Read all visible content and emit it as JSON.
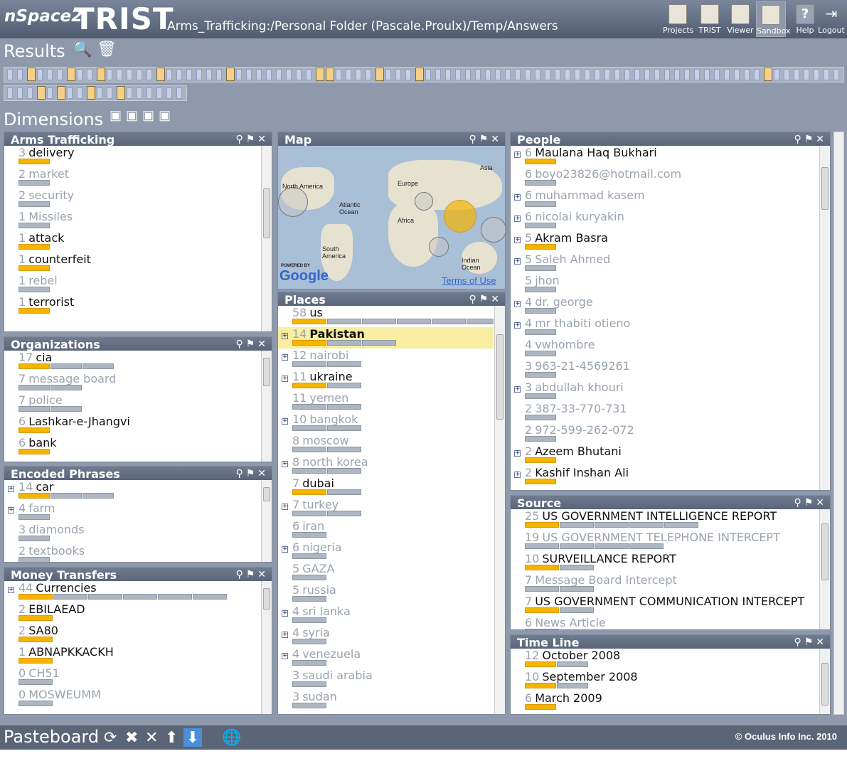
{
  "app": {
    "brand": "nSpace2",
    "product": "TRIST",
    "path": "Arms_Trafficking:/Personal Folder (Pascale.Proulx)/Temp/Answers"
  },
  "toolbar": [
    {
      "label": "Projects",
      "icon": "folders-icon"
    },
    {
      "label": "TRIST",
      "icon": "notebook-icon"
    },
    {
      "label": "Viewer",
      "icon": "document-viewer-icon"
    },
    {
      "label": "Sandbox",
      "icon": "sandbox-icon"
    },
    {
      "label": "Help",
      "icon": "help-icon"
    },
    {
      "label": "Logout",
      "icon": "logout-icon"
    }
  ],
  "results": {
    "title": "Results"
  },
  "dimensions": {
    "title": "Dimensions"
  },
  "pasteboard": {
    "title": "Pasteboard",
    "copyright": "© Oculus Info Inc. 2010"
  },
  "colors": {
    "accent": "#f5b400",
    "header": "#5a6579",
    "highlight": "#f8eda0"
  },
  "map": {
    "title": "Map",
    "labels": [
      "North America",
      "Europe",
      "Asia",
      "Atlantic Ocean",
      "Africa",
      "South America",
      "Indian Ocean"
    ],
    "terms": "Terms of Use",
    "powered": "POWERED BY",
    "google": "Google"
  },
  "panels": {
    "arms": {
      "title": "Arms Trafficking",
      "items": [
        {
          "c": "3",
          "l": "delivery",
          "d": false
        },
        {
          "c": "2",
          "l": "market",
          "d": true
        },
        {
          "c": "2",
          "l": "security",
          "d": true
        },
        {
          "c": "1",
          "l": "Missiles",
          "d": true
        },
        {
          "c": "1",
          "l": "attack",
          "d": false
        },
        {
          "c": "1",
          "l": "counterfeit",
          "d": false
        },
        {
          "c": "1",
          "l": "rebel",
          "d": true
        },
        {
          "c": "1",
          "l": "terrorist",
          "d": false
        }
      ]
    },
    "org": {
      "title": "Organizations",
      "items": [
        {
          "c": "17",
          "l": "cia",
          "d": false
        },
        {
          "c": "7",
          "l": "message board",
          "d": true
        },
        {
          "c": "7",
          "l": "police",
          "d": true
        },
        {
          "c": "6",
          "l": "Lashkar-e-Jhangvi",
          "d": false
        },
        {
          "c": "6",
          "l": "bank",
          "d": false
        }
      ]
    },
    "enc": {
      "title": "Encoded Phrases",
      "items": [
        {
          "c": "14",
          "l": "car",
          "d": false
        },
        {
          "c": "4",
          "l": "farm",
          "d": true
        },
        {
          "c": "3",
          "l": "diamonds",
          "d": true
        },
        {
          "c": "2",
          "l": "textbooks",
          "d": true
        }
      ]
    },
    "money": {
      "title": "Money Transfers",
      "items": [
        {
          "c": "44",
          "l": "Currencies",
          "d": false
        },
        {
          "c": "2",
          "l": "EBILAEAD",
          "d": false
        },
        {
          "c": "2",
          "l": "SA80",
          "d": false
        },
        {
          "c": "1",
          "l": "ABNAPKKACKH",
          "d": false
        },
        {
          "c": "0",
          "l": "CH51",
          "d": true
        },
        {
          "c": "0",
          "l": "MOSWEUMM",
          "d": true
        }
      ]
    },
    "places": {
      "title": "Places",
      "items": [
        {
          "c": "58",
          "l": "us",
          "d": false
        },
        {
          "c": "14",
          "l": "Pakistan",
          "d": false
        },
        {
          "c": "12",
          "l": "nairobi",
          "d": true
        },
        {
          "c": "11",
          "l": "ukraine",
          "d": false
        },
        {
          "c": "11",
          "l": "yemen",
          "d": true
        },
        {
          "c": "10",
          "l": "bangkok",
          "d": true
        },
        {
          "c": "8",
          "l": "moscow",
          "d": true
        },
        {
          "c": "8",
          "l": "north korea",
          "d": true
        },
        {
          "c": "7",
          "l": "dubai",
          "d": false
        },
        {
          "c": "7",
          "l": "turkey",
          "d": true
        },
        {
          "c": "6",
          "l": "iran",
          "d": true
        },
        {
          "c": "6",
          "l": "nigeria",
          "d": true
        },
        {
          "c": "5",
          "l": "GAZA",
          "d": true
        },
        {
          "c": "5",
          "l": "russia",
          "d": true
        },
        {
          "c": "4",
          "l": "sri lanka",
          "d": true
        },
        {
          "c": "4",
          "l": "syria",
          "d": true
        },
        {
          "c": "4",
          "l": "venezuela",
          "d": true
        },
        {
          "c": "3",
          "l": "saudi arabia",
          "d": true
        },
        {
          "c": "3",
          "l": "sudan",
          "d": true
        }
      ]
    },
    "people": {
      "title": "People",
      "items": [
        {
          "c": "6",
          "l": "Maulana Haq Bukhari",
          "d": false
        },
        {
          "c": "6",
          "l": "boyo23826@hotmail.com",
          "d": true
        },
        {
          "c": "6",
          "l": "muhammad kasem",
          "d": true
        },
        {
          "c": "6",
          "l": "nicolai kuryakin",
          "d": true
        },
        {
          "c": "5",
          "l": "Akram Basra",
          "d": false
        },
        {
          "c": "5",
          "l": "Saleh Ahmed",
          "d": true
        },
        {
          "c": "5",
          "l": "jhon",
          "d": true
        },
        {
          "c": "4",
          "l": "dr. george",
          "d": true
        },
        {
          "c": "4",
          "l": "mr thabiti otieno",
          "d": true
        },
        {
          "c": "4",
          "l": "vwhombre",
          "d": true
        },
        {
          "c": "3",
          "l": "963-21-4569261",
          "d": true
        },
        {
          "c": "3",
          "l": "abdullah khouri",
          "d": true
        },
        {
          "c": "2",
          "l": "387-33-770-731",
          "d": true
        },
        {
          "c": "2",
          "l": "972-599-262-072",
          "d": true
        },
        {
          "c": "2",
          "l": "Azeem Bhutani",
          "d": false
        },
        {
          "c": "2",
          "l": "Kashif Inshan Ali",
          "d": false
        }
      ]
    },
    "source": {
      "title": "Source",
      "items": [
        {
          "c": "25",
          "l": "US GOVERNMENT INTELLIGENCE REPORT",
          "d": false
        },
        {
          "c": "19",
          "l": "US GOVERNMENT TELEPHONE INTERCEPT",
          "d": true
        },
        {
          "c": "10",
          "l": "SURVEILLANCE REPORT",
          "d": false
        },
        {
          "c": "7",
          "l": "Message Board Intercept",
          "d": true
        },
        {
          "c": "7",
          "l": "US GOVERNMENT COMMUNICATION INTERCEPT",
          "d": false
        },
        {
          "c": "6",
          "l": "News Article",
          "d": true
        }
      ]
    },
    "timeline": {
      "title": "Time Line",
      "items": [
        {
          "c": "12",
          "l": "October 2008",
          "d": false
        },
        {
          "c": "10",
          "l": "September 2008",
          "d": false
        },
        {
          "c": "6",
          "l": "March 2009",
          "d": false
        }
      ]
    }
  }
}
